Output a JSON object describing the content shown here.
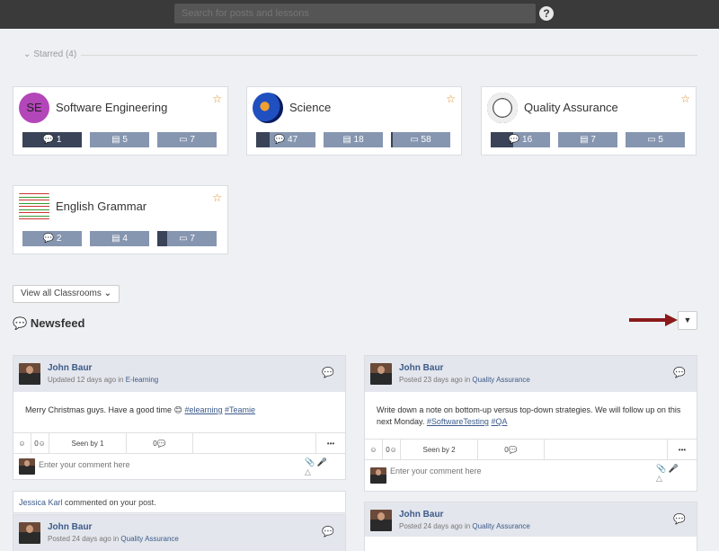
{
  "topbar": {
    "search_placeholder": "Search for posts and lessons",
    "help": "?"
  },
  "starred": {
    "label": "Starred (4)"
  },
  "classrooms": [
    {
      "name": "Software Engineering",
      "logo_text": "SE",
      "posts": "1",
      "lessons": "5",
      "items": "7",
      "posts_fill": 1.0,
      "lessons_fill": 0,
      "items_fill": 0
    },
    {
      "name": "Science",
      "posts": "47",
      "lessons": "18",
      "items": "58",
      "posts_fill": 0.22,
      "lessons_fill": 0,
      "items_fill": 0.03
    },
    {
      "name": "Quality Assurance",
      "posts": "16",
      "lessons": "7",
      "items": "5",
      "posts_fill": 0.38,
      "lessons_fill": 0,
      "items_fill": 0
    },
    {
      "name": "English Grammar",
      "posts": "2",
      "lessons": "4",
      "items": "7",
      "posts_fill": 0,
      "lessons_fill": 0,
      "items_fill": 0.16
    }
  ],
  "view_all": "View all Classrooms",
  "newsfeed": {
    "title": "Newsfeed"
  },
  "posts": [
    {
      "author": "John Baur",
      "meta_prefix": "Updated 12 days ago in",
      "classroom": "E-learning",
      "body": "Merry Christmas guys. Have a good time 😊",
      "tags": [
        "#elearning",
        "#Teamie"
      ],
      "reactions": "0",
      "seen": "Seen by 1",
      "comments": "0",
      "comment_placeholder": "Enter your comment here"
    },
    {
      "author": "John Baur",
      "meta_prefix": "Posted 23 days ago in",
      "classroom": "Quality Assurance",
      "body": "Write down a note on bottom-up versus top-down strategies. We will follow up on this next Monday.",
      "tags": [
        "#SoftwareTesting",
        "#QA"
      ],
      "reactions": "0",
      "seen": "Seen by 2",
      "comments": "0",
      "comment_placeholder": "Enter your comment here"
    },
    {
      "author": "John Baur",
      "meta_prefix": "Posted 24 days ago in",
      "classroom": "Quality Assurance"
    },
    {
      "author": "John Baur",
      "meta_prefix": "Posted 24 days ago in",
      "classroom": "Quality Assurance"
    }
  ],
  "notification": {
    "who": "Jessica Karl",
    "text": "commented on your post."
  },
  "colors": {
    "topbar": "#3a3a3a",
    "stat": "#8696b0",
    "stat_fill": "#3a4357",
    "link": "#3c5a8a",
    "star": "#e08a1e",
    "arrow": "#8b1a1a"
  }
}
